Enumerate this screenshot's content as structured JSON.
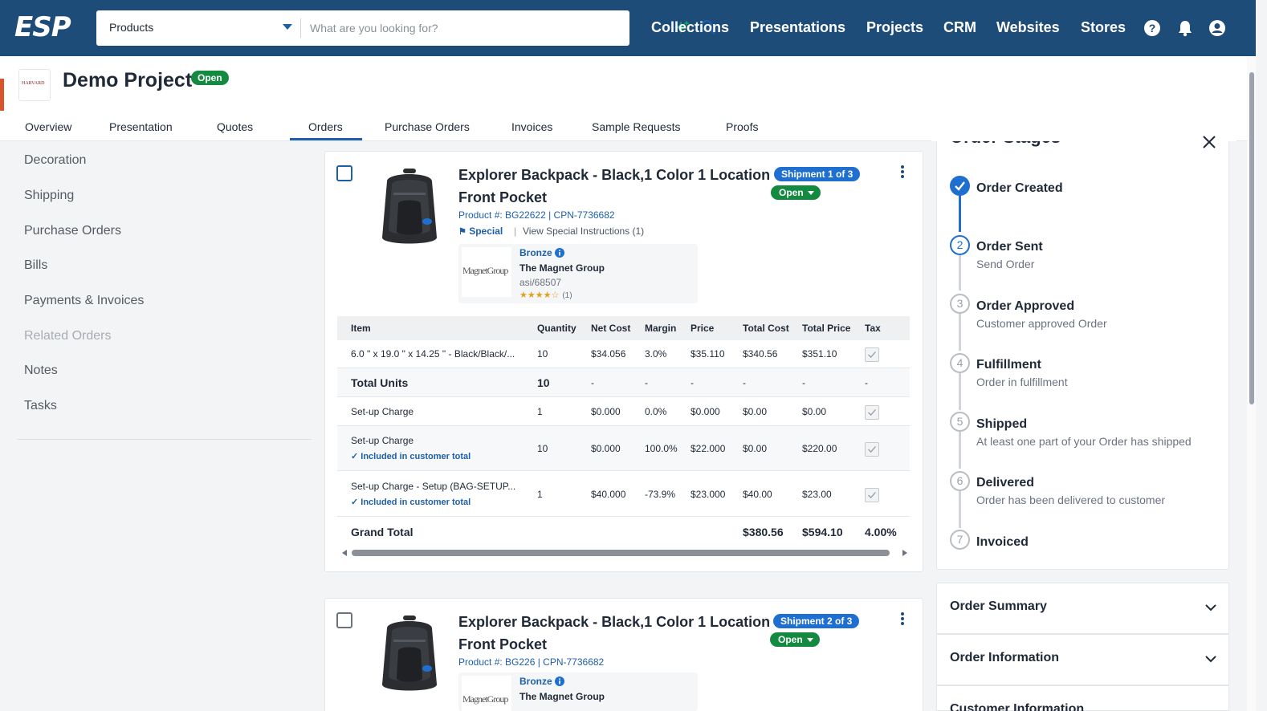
{
  "topbar": {
    "logo": "ESP",
    "search_category": "Products",
    "search_placeholder": "What are you looking for?",
    "nav": [
      "Collections",
      "Presentations",
      "Projects",
      "CRM",
      "Websites",
      "Stores"
    ]
  },
  "project": {
    "logo_text": "HARVARD",
    "title": "Demo Project",
    "status": "Open",
    "tabs": [
      "Overview",
      "Presentation",
      "Quotes",
      "Orders",
      "Purchase Orders",
      "Invoices",
      "Sample Requests",
      "Proofs"
    ],
    "active_tab": "Orders"
  },
  "side_menu": [
    "Decoration",
    "Shipping",
    "Purchase Orders",
    "Bills",
    "Payments & Invoices",
    "Related Orders",
    "Notes",
    "Tasks"
  ],
  "cards": [
    {
      "title_line1": "Explorer Backpack - Black,1 Color 1 Location",
      "title_line2": "Front Pocket",
      "shipment": "Shipment 1 of 3",
      "status": "Open",
      "product_num": "Product #: BG22622 | CPN-7736682",
      "special": "Special",
      "view_instructions": "View Special Instructions (1)",
      "supplier": {
        "logo_text": "MagnetGroup",
        "tier": "Bronze",
        "name": "The Magnet Group",
        "asi": "asi/68507",
        "stars": "★★★★☆",
        "rating_count": "(1)"
      },
      "table": {
        "headers": [
          "Item",
          "Quantity",
          "Net Cost",
          "Margin",
          "Price",
          "Total Cost",
          "Total Price",
          "Tax"
        ],
        "row1": [
          "6.0 \" x 19.0 \" x 14.25 \" - Black/Black/...",
          "10",
          "$34.056",
          "3.0%",
          "$35.110",
          "$340.56",
          "$351.10"
        ],
        "total_units": [
          "Total Units",
          "10",
          "-",
          "-",
          "-",
          "-",
          "-",
          "-"
        ],
        "setup1": [
          "Set-up Charge",
          "1",
          "$0.000",
          "0.0%",
          "$0.000",
          "$0.00",
          "$0.00"
        ],
        "setup2": [
          "Set-up Charge",
          "10",
          "$0.000",
          "100.0%",
          "$22.000",
          "$0.00",
          "$220.00"
        ],
        "setup3": [
          "Set-up Charge - Setup (BAG-SETUP...",
          "1",
          "$40.000",
          "-73.9%",
          "$23.000",
          "$40.00",
          "$23.00"
        ],
        "included_label": "Included in customer total",
        "grand_total": [
          "Grand Total",
          "$380.56",
          "$594.10",
          "4.00%"
        ]
      }
    },
    {
      "title_line1": "Explorer Backpack - Black,1 Color 1 Location",
      "title_line2": "Front Pocket",
      "shipment": "Shipment 2 of 3",
      "status": "Open",
      "product_num": "Product #: BG226 | CPN-7736682",
      "supplier": {
        "logo_text": "MagnetGroup",
        "tier": "Bronze",
        "name": "The Magnet Group"
      }
    }
  ],
  "order_stages": {
    "title": "Order Stages",
    "stages": [
      {
        "num": "1",
        "name": "Order Created",
        "sub": ""
      },
      {
        "num": "2",
        "name": "Order Sent",
        "sub": "Send Order"
      },
      {
        "num": "3",
        "name": "Order Approved",
        "sub": "Customer approved Order"
      },
      {
        "num": "4",
        "name": "Fulfillment",
        "sub": "Order in fulfillment"
      },
      {
        "num": "5",
        "name": "Shipped",
        "sub": "At least one part of your Order has shipped"
      },
      {
        "num": "6",
        "name": "Delivered",
        "sub": "Order has been delivered to customer"
      },
      {
        "num": "7",
        "name": "Invoiced",
        "sub": ""
      }
    ]
  },
  "accordions": [
    "Order Summary",
    "Order Information",
    "Customer Information"
  ],
  "colors": {
    "topbar": "#1e4c78",
    "accent": "#1e5fa8",
    "status_green": "#138a3f",
    "shipment_blue": "#1e6fd0",
    "brand_red": "#d9532b"
  }
}
